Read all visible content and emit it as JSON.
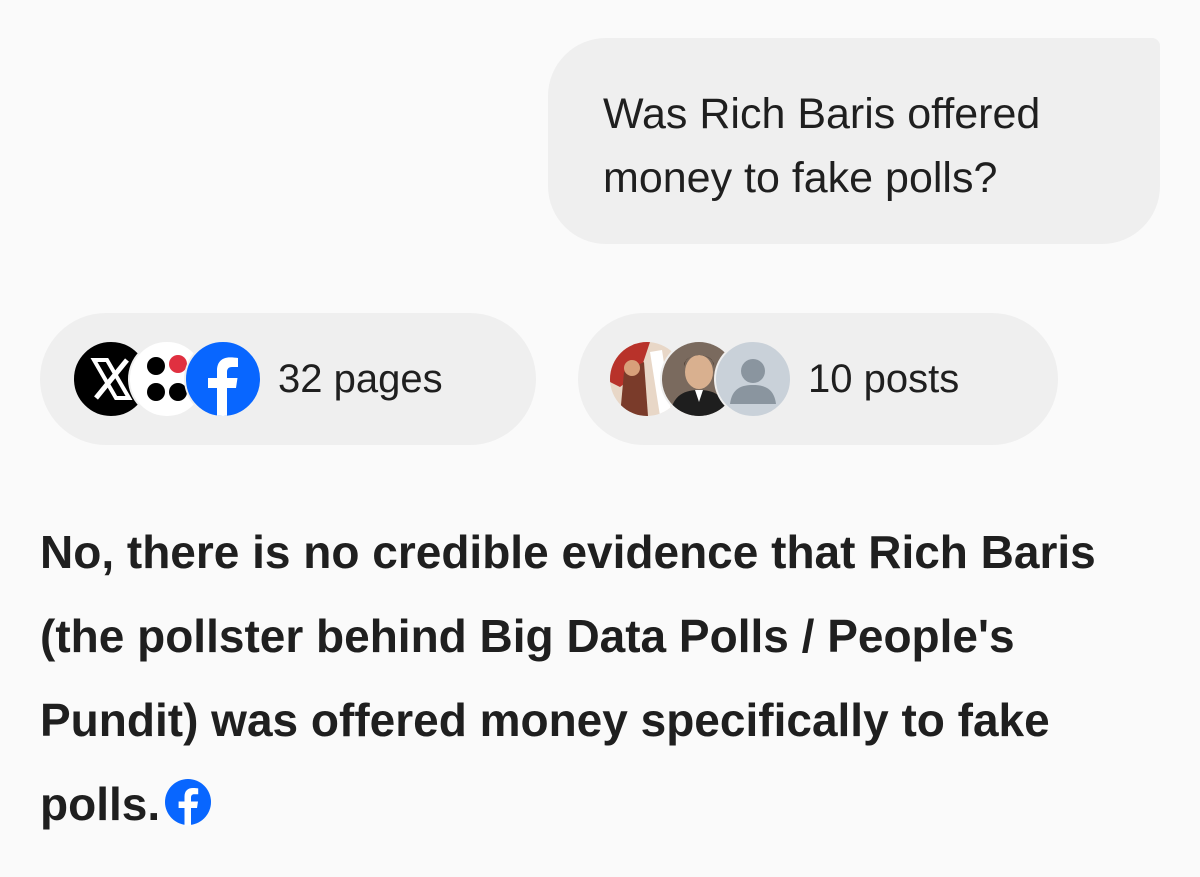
{
  "user_message": {
    "text": "Was Rich Baris offered money to fake polls?"
  },
  "sources": {
    "pages": {
      "label": "32 pages",
      "icons": [
        "x-logo-icon",
        "dots-logo-icon",
        "facebook-logo-icon"
      ]
    },
    "posts": {
      "label": "10 posts",
      "icons": [
        "profile-photo-avatar",
        "profile-photo-avatar",
        "default-user-avatar-icon"
      ]
    }
  },
  "answer": {
    "text": "No, there is no credible evidence that Rich Baris (the pollster behind Big Data Polls / People's Pundit) was offered money specifically to fake polls.",
    "citation_icon": "facebook-logo-icon"
  },
  "colors": {
    "background": "#fafafa",
    "bubble": "#efefef",
    "facebook_blue": "#0866ff",
    "text": "#1f1f1f"
  }
}
